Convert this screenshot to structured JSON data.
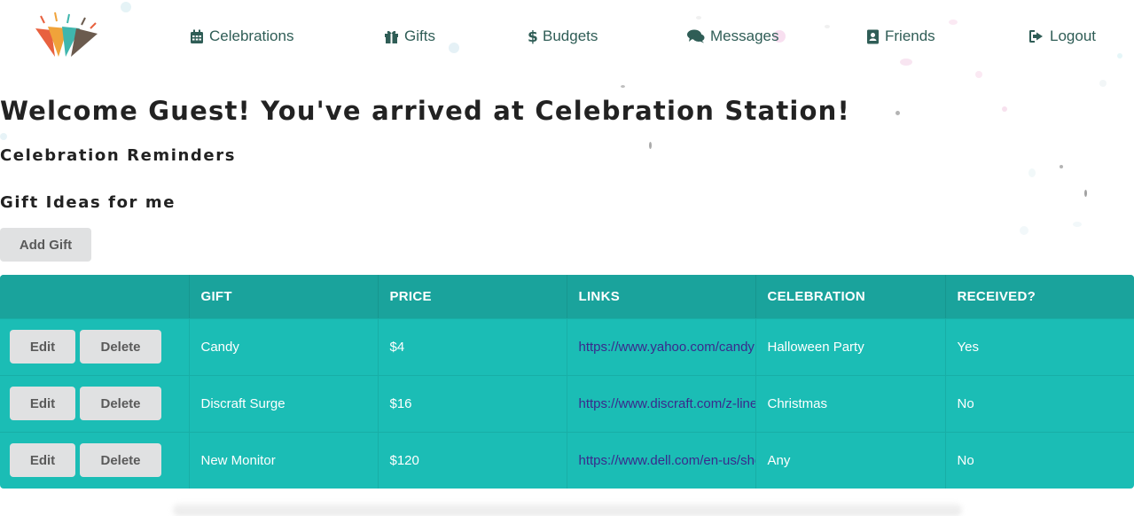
{
  "nav": {
    "logo_icon": "party-hat-logo",
    "items": [
      {
        "label": "Celebrations",
        "icon": "calendar-icon"
      },
      {
        "label": "Gifts",
        "icon": "gift-icon"
      },
      {
        "label": "Budgets",
        "icon": "dollar-icon"
      },
      {
        "label": "Messages",
        "icon": "comments-icon"
      },
      {
        "label": "Friends",
        "icon": "address-book-icon"
      },
      {
        "label": "Logout",
        "icon": "sign-out-icon"
      }
    ]
  },
  "main": {
    "welcome": "Welcome Guest! You've arrived at Celebration Station!",
    "reminders_heading": "Celebration Reminders",
    "gift_ideas_heading": "Gift Ideas for me",
    "add_gift_label": "Add Gift"
  },
  "table": {
    "columns": [
      "",
      "GIFT",
      "PRICE",
      "LINKS",
      "CELEBRATION",
      "RECEIVED?"
    ],
    "edit_label": "Edit",
    "delete_label": "Delete",
    "rows": [
      {
        "gift": "Candy",
        "price": "$4",
        "link": "https://www.yahoo.com/candy",
        "celebration": "Halloween Party",
        "received": "Yes"
      },
      {
        "gift": "Discraft Surge",
        "price": "$16",
        "link": "https://www.discraft.com/z-line",
        "celebration": "Christmas",
        "received": "No"
      },
      {
        "gift": "New Monitor",
        "price": "$120",
        "link": "https://www.dell.com/en-us/shop",
        "celebration": "Any",
        "received": "No"
      }
    ]
  },
  "colors": {
    "nav_text": "#2f5d56",
    "table_body": "#1bbdb5",
    "table_header": "#1aa39c",
    "link": "#3a2a8c",
    "button_bg": "#e0e1e2"
  }
}
